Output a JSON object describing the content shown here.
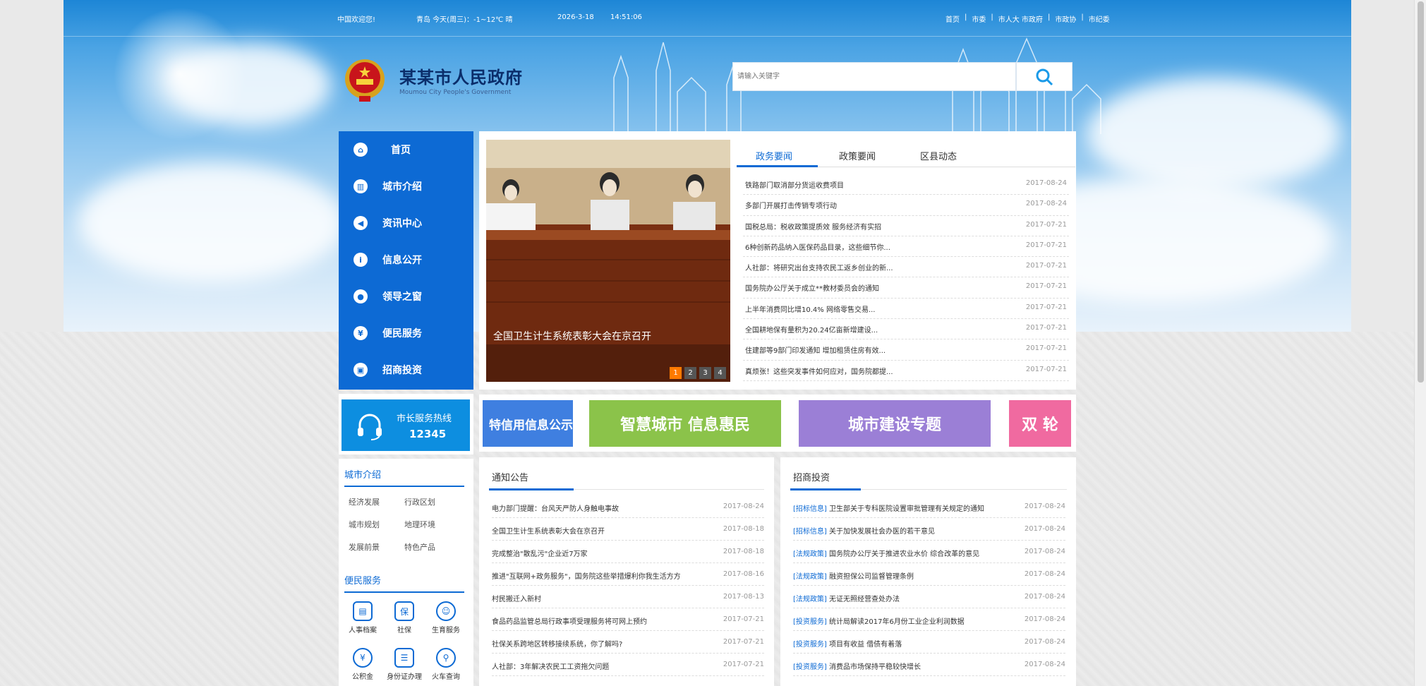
{
  "topbar": {
    "welcome": "中国欢迎您!",
    "weather": "青岛   今天(周三)：-1~12℃ 晴",
    "date": "2026-3-18",
    "time": "14:51:06",
    "links": [
      "首页",
      "市委",
      "市人大 市政府",
      "市政协",
      "市纪委"
    ]
  },
  "header": {
    "title": "某某市人民政府",
    "subtitle": "Moumou City People's Government"
  },
  "search": {
    "placeholder": "请输入关键字",
    "value": ""
  },
  "sidenav": {
    "items": [
      {
        "label": "首页",
        "icon": "home-icon"
      },
      {
        "label": "城市介绍",
        "icon": "building-icon"
      },
      {
        "label": "资讯中心",
        "icon": "megaphone-icon"
      },
      {
        "label": "信息公开",
        "icon": "info-icon"
      },
      {
        "label": "领导之窗",
        "icon": "leader-icon"
      },
      {
        "label": "便民服务",
        "icon": "service-icon"
      },
      {
        "label": "招商投资",
        "icon": "briefcase-icon"
      }
    ]
  },
  "slider": {
    "caption": "全国卫生计生系统表彰大会在京召开",
    "pages": [
      "1",
      "2",
      "3",
      "4"
    ],
    "active_page": "1"
  },
  "tabs": [
    "政务要闻",
    "政策要闻",
    "区县动态"
  ],
  "news": [
    {
      "title": "铁路部门取消部分货运收费项目",
      "date": "2017-08-24"
    },
    {
      "title": "多部门开展打击传销专项行动",
      "date": "2017-08-24"
    },
    {
      "title": "国税总局：税收政策提质效 服务经济有实招",
      "date": "2017-07-21"
    },
    {
      "title": "6种创新药品纳入医保药品目录，这些细节你...",
      "date": "2017-07-21"
    },
    {
      "title": "人社部：将研究出台支持农民工返乡创业的新...",
      "date": "2017-07-21"
    },
    {
      "title": "国务院办公厅关于成立**教材委员会的通知",
      "date": "2017-07-21"
    },
    {
      "title": "上半年消费同比增10.4% 网络零售交易...",
      "date": "2017-07-21"
    },
    {
      "title": "全国耕地保有量积为20.24亿亩新增建设...",
      "date": "2017-07-21"
    },
    {
      "title": "住建部等9部门印发通知 增加租赁住房有效...",
      "date": "2017-07-21"
    },
    {
      "title": "真烦张！这些突发事件如何应对，国务院都提...",
      "date": "2017-07-21"
    }
  ],
  "hotline": {
    "label": "市长服务热线",
    "number": "12345"
  },
  "banners": [
    {
      "text": "特信用信息公示",
      "color": "#3f7fe0"
    },
    {
      "text": "智慧城市 信息惠民",
      "color": "#8bc34a"
    },
    {
      "text": "城市建设专题",
      "color": "#9b7fd6"
    },
    {
      "text": "双 轮",
      "color": "#f06aa0"
    }
  ],
  "city_intro": {
    "title": "城市介绍",
    "links": [
      "经济发展",
      "行政区划",
      "城市规划",
      "地理环境",
      "发展前景",
      "特色产品"
    ]
  },
  "services": {
    "title": "便民服务",
    "items": [
      {
        "label": "人事档案",
        "icon": "file-icon"
      },
      {
        "label": "社保",
        "icon": "shield-icon"
      },
      {
        "label": "生育服务",
        "icon": "baby-icon"
      },
      {
        "label": "公积金",
        "icon": "yuan-icon"
      },
      {
        "label": "身份证办理",
        "icon": "id-card-icon"
      },
      {
        "label": "火车查询",
        "icon": "train-icon"
      }
    ]
  },
  "notices": {
    "title": "通知公告",
    "items": [
      {
        "title": "电力部门提醒：台风天严防人身触电事故",
        "date": "2017-08-24"
      },
      {
        "title": "全国卫生计生系统表彰大会在京召开",
        "date": "2017-08-18"
      },
      {
        "title": "完成整治\"散乱污\"企业近7万家",
        "date": "2017-08-18"
      },
      {
        "title": "推进\"互联网+政务服务\"，国务院这些举措爆利你我生活方方",
        "date": "2017-08-16"
      },
      {
        "title": "村民搬迁入新村",
        "date": "2017-08-13"
      },
      {
        "title": "食品药品监管总局行政事项受理服务将可网上预约",
        "date": "2017-07-21"
      },
      {
        "title": "社保关系跨地区转移接续系统，你了解吗?",
        "date": "2017-07-21"
      },
      {
        "title": "人社部：3年解决农民工工资拖欠问题",
        "date": "2017-07-21"
      }
    ]
  },
  "investment": {
    "title": "招商投资",
    "items": [
      {
        "tag": "[招标信息]",
        "title": "卫生部关于专科医院设置审批管理有关规定的通知",
        "date": "2017-08-24"
      },
      {
        "tag": "[招标信息]",
        "title": "关于加快发展社会办医的若干意见",
        "date": "2017-08-24"
      },
      {
        "tag": "[法规政策]",
        "title": "国务院办公厅关于推进农业水价 综合改革的意见",
        "date": "2017-08-24"
      },
      {
        "tag": "[法规政策]",
        "title": "融资担保公司监督管理条例",
        "date": "2017-08-24"
      },
      {
        "tag": "[法规政策]",
        "title": "无证无照经营查处办法",
        "date": "2017-08-24"
      },
      {
        "tag": "[投资服务]",
        "title": "统计局解读2017年6月份工业企业利润数据",
        "date": "2017-08-24"
      },
      {
        "tag": "[投资服务]",
        "title": "项目有收益 借债有着落",
        "date": "2017-08-24"
      },
      {
        "tag": "[投资服务]",
        "title": "消费品市场保持平稳较快增长",
        "date": "2017-08-24"
      }
    ]
  }
}
